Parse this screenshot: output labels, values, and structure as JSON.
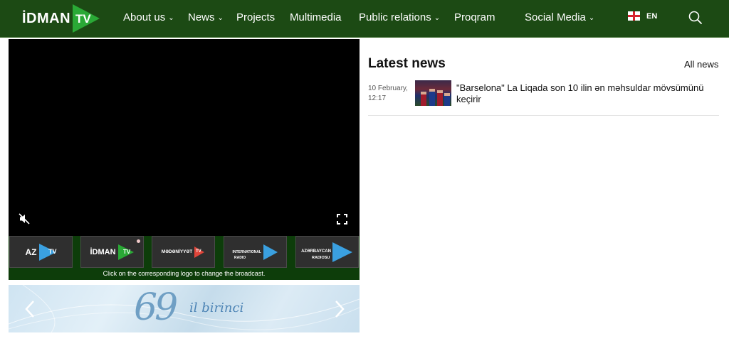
{
  "header": {
    "logo_text": "İDMAN",
    "logo_tv": "TV",
    "nav": [
      {
        "label": "About us",
        "has_dropdown": true
      },
      {
        "label": "News",
        "has_dropdown": true
      },
      {
        "label": "Projects",
        "has_dropdown": false
      },
      {
        "label": "Multimedia",
        "has_dropdown": false
      },
      {
        "label": "Public relations",
        "has_dropdown": true
      },
      {
        "label": "Proqram",
        "has_dropdown": false
      },
      {
        "label": "Social Media",
        "has_dropdown": true
      }
    ],
    "language": "EN",
    "icons": {
      "search": "search-icon",
      "flag": "england-flag-icon"
    }
  },
  "player": {
    "icons": {
      "mute": "mute-icon",
      "fullscreen": "fullscreen-icon"
    },
    "channels": [
      {
        "label": "AZ TV",
        "part1": "AZ",
        "part2": "TV"
      },
      {
        "label": "İDMAN TV",
        "part1": "İDMAN",
        "part2": "TV"
      },
      {
        "label": "Mədəniyyət TV",
        "part1": "MƏDƏNİYYƏT",
        "part2": "TV"
      },
      {
        "label": "International Radio",
        "part1": "INTERNATIONAL",
        "part2": "RADIO"
      },
      {
        "label": "Azərbaycan Radiosu 105FM",
        "part1": "AZƏRBAYCAN",
        "part2": "RADIOSU"
      }
    ],
    "hint": "Click on the corresponding logo to change the broadcast."
  },
  "banner": {
    "number": "69",
    "text": "il birinci",
    "icons": {
      "prev": "chevron-left-icon",
      "next": "chevron-right-icon"
    }
  },
  "latest_news": {
    "title": "Latest news",
    "all_link": "All news",
    "items": [
      {
        "date": "10 February, 12:17",
        "headline": "\"Barselona\" La Liqada son 10 ilin ən məhsuldar mövsümünü keçirir"
      }
    ]
  },
  "colors": {
    "header_bg": "#1c4a14",
    "logo_green": "#2aa936",
    "channel_bar_bg": "#0d3d0a",
    "accent_blue": "#3aa0e0"
  }
}
